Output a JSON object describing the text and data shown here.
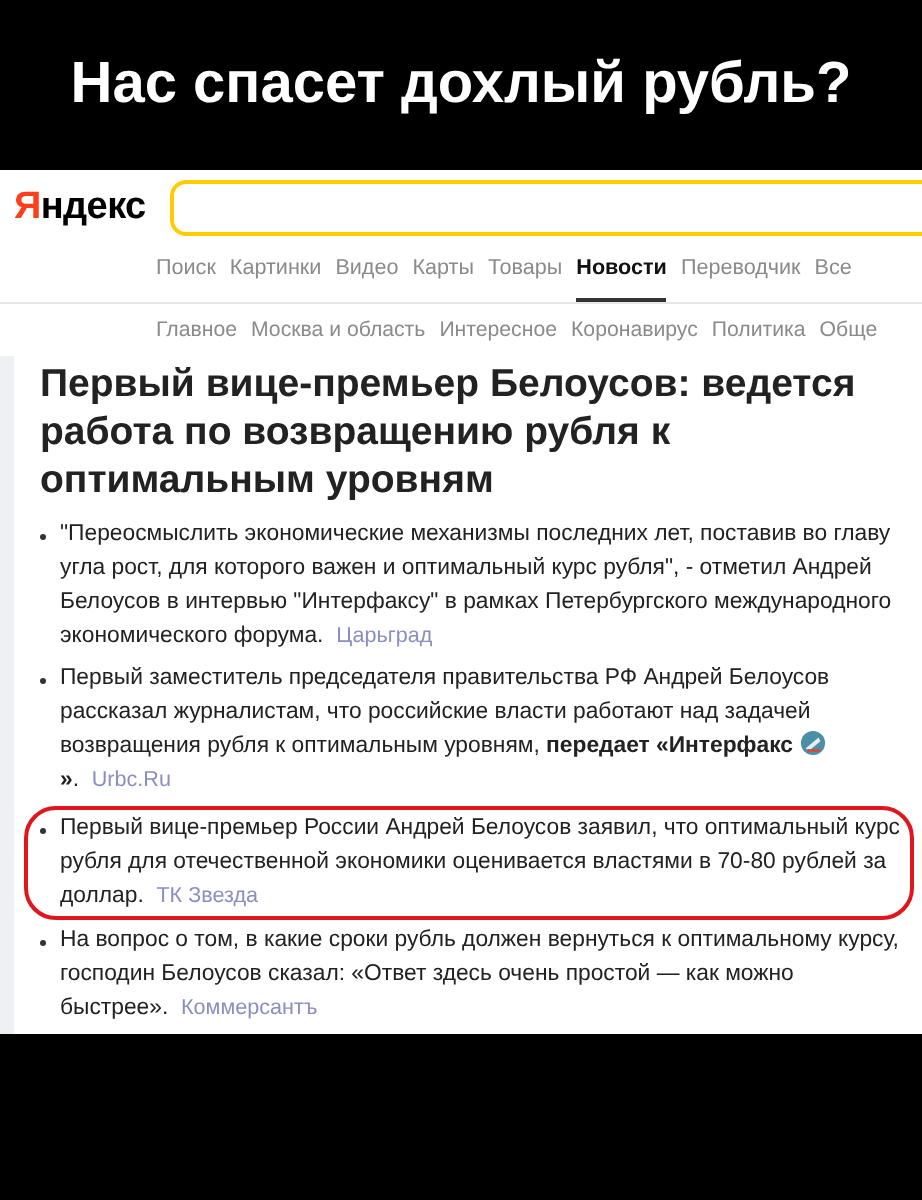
{
  "caption": "Нас спасет дохлый рубль?",
  "header": {
    "logo_first": "Я",
    "logo_rest": "ндекс"
  },
  "tabs": [
    {
      "label": "Поиск",
      "selected": false
    },
    {
      "label": "Картинки",
      "selected": false
    },
    {
      "label": "Видео",
      "selected": false
    },
    {
      "label": "Карты",
      "selected": false
    },
    {
      "label": "Товары",
      "selected": false
    },
    {
      "label": "Новости",
      "selected": true
    },
    {
      "label": "Переводчик",
      "selected": false
    },
    {
      "label": "Все",
      "selected": false
    }
  ],
  "categories": [
    "Главное",
    "Москва и область",
    "Интересное",
    "Коронавирус",
    "Политика",
    "Обще"
  ],
  "headline": "Первый вице-премьер Белоусов: ведется работа по возвращению рубля к оптимальным уровням",
  "items": [
    {
      "text": "\"Переосмыслить экономические механизмы последних лет, поставив во главу угла рост, для которого важен и оптимальный курс рубля\", - отметил Андрей Белоусов в интервью \"Интерфаксу\" в рамках Петербургского международного экономического форума.",
      "source": "Царьград",
      "highlighted": false
    },
    {
      "text": "Первый заместитель председателя правительства РФ Андрей Белоусов рассказал журналистам, что российские власти работают над задачей возвращения рубля к оптимальным уровням, **передает «Интерфакс**",
      "source_icon": true,
      "text_after": "**»**.",
      "source": "Urbc.Ru",
      "highlighted": false
    },
    {
      "text": "Первый вице-премьер России Андрей Белоусов заявил, что оптимальный курс рубля для отечественной экономики оценивается властями в 70-80 рублей за доллар.",
      "source": "ТК Звезда",
      "highlighted": true
    },
    {
      "text": "На вопрос о том, в какие сроки рубль должен вернуться к оптимальному курсу, господин Белоусов сказал: «Ответ здесь очень простой — как можно быстрее».",
      "source": "Коммерсантъ",
      "highlighted": false
    }
  ]
}
